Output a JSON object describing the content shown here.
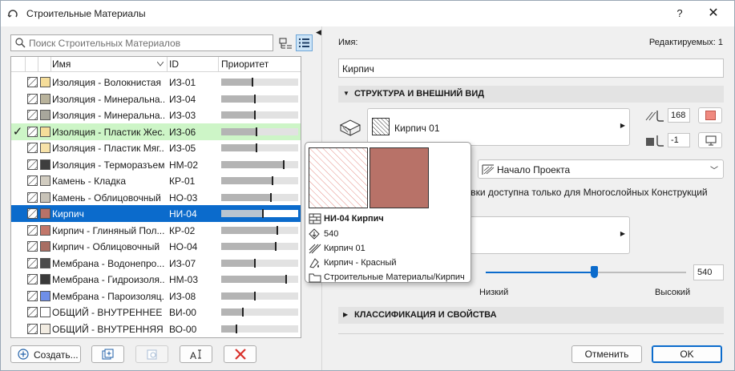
{
  "window": {
    "title": "Строительные Материалы",
    "help_label": "?",
    "close_label": "✕"
  },
  "left": {
    "search_placeholder": "Поиск Строительных Материалов",
    "columns": {
      "name": "Имя",
      "id": "ID",
      "priority": "Приоритет"
    },
    "rows": [
      {
        "name": "Изоляция - Волокнистая ...",
        "id": "ИЗ-01",
        "priority": 0.41,
        "sw2": "#f5dd9a",
        "checked": false,
        "selected": false
      },
      {
        "name": "Изоляция - Минеральна...",
        "id": "ИЗ-04",
        "priority": 0.44,
        "sw2": "#b9b39c",
        "checked": false,
        "selected": false
      },
      {
        "name": "Изоляция - Минеральна...",
        "id": "ИЗ-03",
        "priority": 0.44,
        "sw2": "#a8a79c",
        "checked": false,
        "selected": false
      },
      {
        "name": "Изоляция - Пластик Жес...",
        "id": "ИЗ-06",
        "priority": 0.46,
        "sw2": "#f5dd9a",
        "checked": true,
        "selected": false
      },
      {
        "name": "Изоляция - Пластик Мяг...",
        "id": "ИЗ-05",
        "priority": 0.46,
        "sw2": "#f7e2a8",
        "checked": false,
        "selected": false
      },
      {
        "name": "Изоляция - Терморазъем",
        "id": "НМ-02",
        "priority": 0.81,
        "sw2": "#3e3e3e",
        "checked": false,
        "selected": false
      },
      {
        "name": "Камень - Кладка",
        "id": "КР-01",
        "priority": 0.67,
        "sw2": "#d1ccc0",
        "checked": false,
        "selected": false
      },
      {
        "name": "Камень - Облицовочный",
        "id": "НО-03",
        "priority": 0.65,
        "sw2": "#c8c3b8",
        "checked": false,
        "selected": false
      },
      {
        "name": "Кирпич",
        "id": "НИ-04",
        "priority": 0.54,
        "sw2": "#b87268",
        "checked": false,
        "selected": true
      },
      {
        "name": "Кирпич - Глиняный Пол...",
        "id": "КР-02",
        "priority": 0.73,
        "sw2": "#c2776a",
        "checked": false,
        "selected": false
      },
      {
        "name": "Кирпич - Облицовочный",
        "id": "НО-04",
        "priority": 0.71,
        "sw2": "#a86e63",
        "checked": false,
        "selected": false
      },
      {
        "name": "Мембрана - Водонепро...",
        "id": "ИЗ-07",
        "priority": 0.44,
        "sw2": "#4d4d4d",
        "checked": false,
        "selected": false
      },
      {
        "name": "Мембрана - Гидроизоля...",
        "id": "НМ-03",
        "priority": 0.84,
        "sw2": "#3a3a3a",
        "checked": false,
        "selected": false
      },
      {
        "name": "Мембрана - Пароизоляц...",
        "id": "ИЗ-08",
        "priority": 0.44,
        "sw2": "#6f8fe8",
        "checked": false,
        "selected": false
      },
      {
        "name": "ОБЩИЙ - ВНУТРЕННЕЕ И...",
        "id": "ВИ-00",
        "priority": 0.28,
        "sw2": "#ffffff",
        "checked": false,
        "selected": false
      },
      {
        "name": "ОБЩИЙ - ВНУТРЕННЯЯ О...",
        "id": "ВО-00",
        "priority": 0.2,
        "sw2": "#f2ece2",
        "checked": false,
        "selected": false
      }
    ],
    "create_label": "Создать..."
  },
  "right": {
    "name_label": "Имя:",
    "editable_label": "Редактируемых: 1",
    "name_value": "Кирпич",
    "section_structure": "СТРУКТУРА И ВНЕШНИЙ ВИД",
    "cut_fill_name": "Кирпич 01",
    "pen_fg_value": "168",
    "pen_bg_value": "-1",
    "fill_origin": "Начало Проекта",
    "note": "иховки доступна только для Многослойных Конструкций",
    "priority_value": "540",
    "priority_fraction": 0.54,
    "priority_low": "Низкий",
    "priority_high": "Высокий",
    "section_classification": "КЛАССИФИКАЦИЯ И СВОЙСТВА",
    "cancel_label": "Отменить",
    "ok_label": "OK"
  },
  "popup": {
    "id_name": "НИ-04 Кирпич",
    "priority": "540",
    "fill": "Кирпич 01",
    "surface": "Кирпич - Красный",
    "folder": "Строительные Материалы/Кирпич",
    "surface_color": "#b87268"
  },
  "colors": {
    "accent": "#0b6bcc",
    "checked_row": "#cdf5c7",
    "pen_swatch": "#f08a80"
  }
}
